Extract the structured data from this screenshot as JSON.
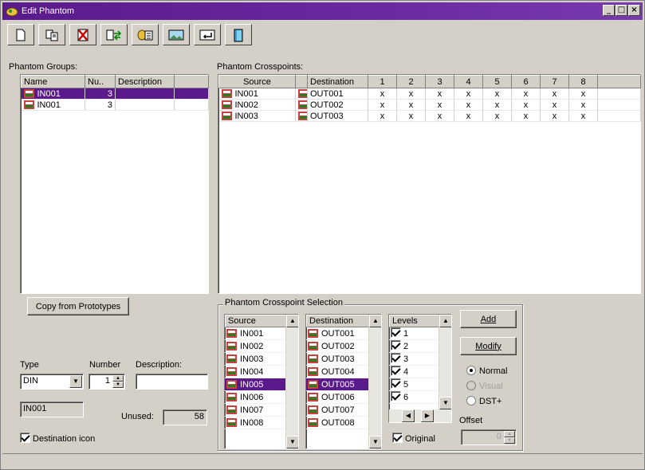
{
  "window": {
    "title": "Edit Phantom",
    "minimize": "_",
    "maximize": "□",
    "close": "×"
  },
  "toolbar": {
    "buttons": [
      {
        "name": "new-icon"
      },
      {
        "name": "copy-icon"
      },
      {
        "name": "delete-icon"
      },
      {
        "name": "swap-icon"
      },
      {
        "name": "edit-list-icon"
      },
      {
        "name": "image-icon"
      },
      {
        "name": "return-icon"
      },
      {
        "name": "exit-door-icon"
      }
    ]
  },
  "groups": {
    "label": "Phantom Groups:",
    "headers": [
      "Name",
      "Nu..",
      "Description"
    ],
    "rows": [
      {
        "name": "IN001",
        "num": "3",
        "desc": "",
        "selected": true
      },
      {
        "name": "IN001",
        "num": "3",
        "desc": "",
        "selected": false
      }
    ]
  },
  "crosspoints": {
    "label": "Phantom Crosspoints:",
    "headers": [
      "Source",
      "",
      "Destination",
      "1",
      "2",
      "3",
      "4",
      "5",
      "6",
      "7",
      "8"
    ],
    "rows": [
      {
        "source": "IN001",
        "dest": "OUT001",
        "levels": [
          "x",
          "x",
          "x",
          "x",
          "x",
          "x",
          "x",
          "x"
        ]
      },
      {
        "source": "IN002",
        "dest": "OUT002",
        "levels": [
          "x",
          "x",
          "x",
          "x",
          "x",
          "x",
          "x",
          "x"
        ]
      },
      {
        "source": "IN003",
        "dest": "OUT003",
        "levels": [
          "x",
          "x",
          "x",
          "x",
          "x",
          "x",
          "x",
          "x"
        ]
      }
    ]
  },
  "copy_button": "Copy from Prototypes",
  "form": {
    "type_label": "Type",
    "type_value": "DIN",
    "number_label": "Number",
    "number_value": "1",
    "description_label": "Description:",
    "description_value": "",
    "name_value": "IN001",
    "unused_label": "Unused:",
    "unused_value": "58",
    "dest_icon_label": "Destination icon",
    "dest_icon_checked": true
  },
  "selection": {
    "label": "Phantom Crosspoint Selection",
    "source_header": "Source",
    "sources": [
      "IN001",
      "IN002",
      "IN003",
      "IN004",
      "IN005",
      "IN006",
      "IN007",
      "IN008"
    ],
    "source_selected": 4,
    "dest_header": "Destination",
    "dests": [
      "OUT001",
      "OUT002",
      "OUT003",
      "OUT004",
      "OUT005",
      "OUT006",
      "OUT007",
      "OUT008"
    ],
    "dest_selected": 4,
    "levels_header": "Levels",
    "levels": [
      "1",
      "2",
      "3",
      "4",
      "5",
      "6"
    ],
    "add": "Add",
    "modify": "Modify",
    "radio_normal": "Normal",
    "radio_visual": "Visual",
    "radio_dst": "DST+",
    "offset_label": "Offset",
    "offset_value": "0",
    "original_label": "Original"
  }
}
